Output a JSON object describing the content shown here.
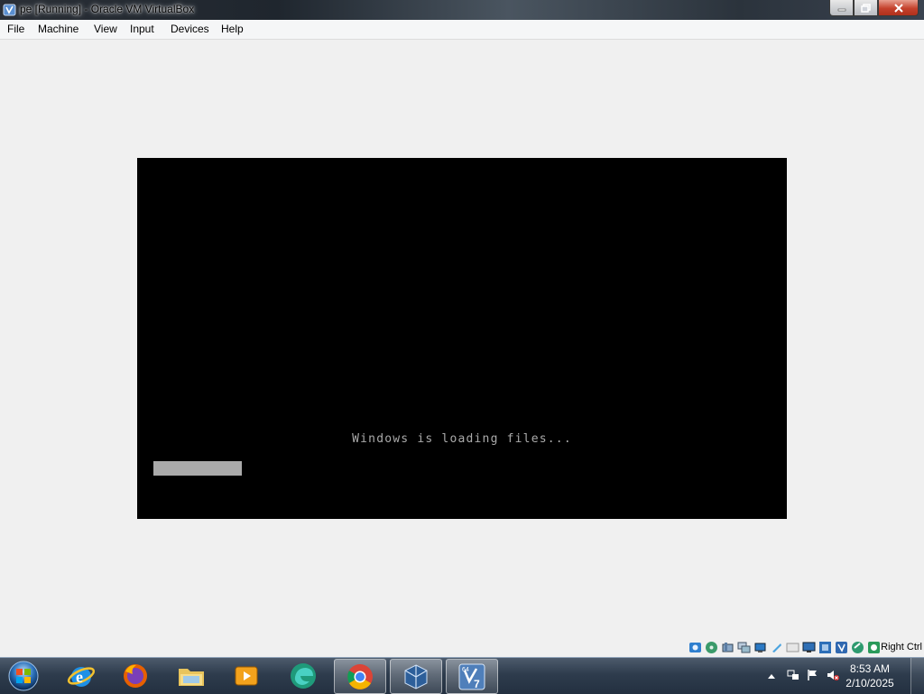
{
  "window": {
    "title": "pe [Running] - Oracle VM VirtualBox"
  },
  "menu": {
    "items": [
      "File",
      "Machine",
      "View",
      "Input",
      "Devices",
      "Help"
    ]
  },
  "vm": {
    "boot_message": "Windows is loading files...",
    "progress_fraction": 0.14
  },
  "statusbar": {
    "icons": [
      "hard-disk",
      "optical-drive",
      "audio",
      "network",
      "usb",
      "shared-folders",
      "display",
      "video-capture",
      "cpu-virtualization",
      "mouse-integration",
      "host-key-state"
    ],
    "host_key": "Right Ctrl"
  },
  "taskbar": {
    "apps": [
      "internet-explorer",
      "firefox",
      "file-explorer",
      "media-player",
      "edge",
      "chrome",
      "virtualbox",
      "windows7-vm"
    ],
    "active_app": "windows7-vm"
  },
  "clock": {
    "time": "8:53 AM",
    "date": "2/10/2025"
  },
  "colors": {
    "vm_text": "#aaaaaa",
    "vm_background": "#000000",
    "window_background": "#f0f0f0"
  }
}
